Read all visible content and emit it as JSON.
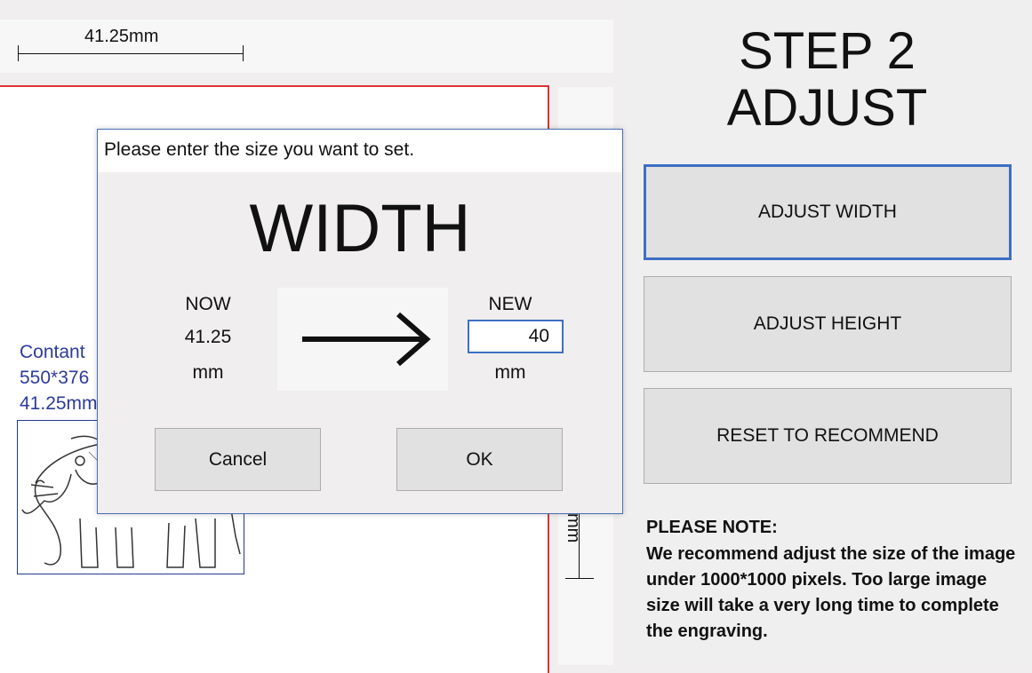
{
  "ruler": {
    "width_label": "41.25mm",
    "height_label": "mm"
  },
  "image_info": {
    "line1": "Contant",
    "line2": "550*376",
    "line3": "41.25mm"
  },
  "panel": {
    "title_line1": "STEP 2",
    "title_line2": "ADJUST",
    "adjust_width_label": "ADJUST WIDTH",
    "adjust_height_label": "ADJUST HEIGHT",
    "reset_label": "RESET TO RECOMMEND",
    "note_title": "PLEASE NOTE:",
    "note_body": "We recommend  adjust the size of the image under 1000*1000 pixels. Too large image size will take a very long time to complete the engraving."
  },
  "dialog": {
    "prompt": "Please enter the size you want to set.",
    "title": "WIDTH",
    "now_label": "NOW",
    "now_value": "41.25",
    "now_unit": "mm",
    "new_label": "NEW",
    "new_value": "40",
    "new_unit": "mm",
    "cancel_label": "Cancel",
    "ok_label": "OK"
  },
  "colors": {
    "accent": "#3d6fc4",
    "canvas_border": "#dd3333",
    "info_text": "#2d3b9a"
  },
  "icons": [
    "right-arrow-icon",
    "elephant-image"
  ]
}
